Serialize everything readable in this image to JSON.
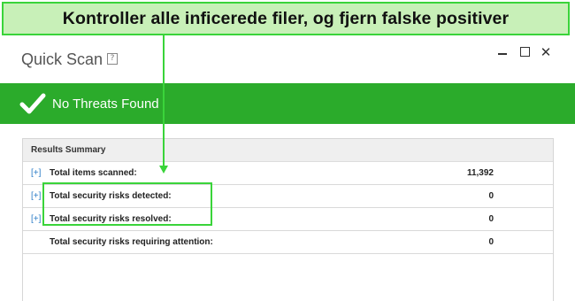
{
  "callout": {
    "text": "Kontroller alle inficerede filer, og fjern falske positiver"
  },
  "window": {
    "title": "Quick Scan",
    "help_glyph": "?",
    "controls": {
      "minimize": "minimize",
      "maximize": "maximize",
      "close": "✕"
    }
  },
  "status": {
    "text": "No Threats Found",
    "icon": "checkmark-icon"
  },
  "results": {
    "header": "Results Summary",
    "rows": [
      {
        "expander": "[+]",
        "label": "Total items scanned:",
        "value": "11,392"
      },
      {
        "expander": "[+]",
        "label": "Total security risks detected:",
        "value": "0"
      },
      {
        "expander": "[+]",
        "label": "Total security risks resolved:",
        "value": "0"
      },
      {
        "expander": "",
        "label": "Total security risks requiring attention:",
        "value": "0"
      }
    ]
  },
  "colors": {
    "status_green": "#2bab2b",
    "highlight_green": "#3ad43a",
    "callout_bg": "#c8f0b8",
    "link_blue": "#2f7fc8"
  }
}
